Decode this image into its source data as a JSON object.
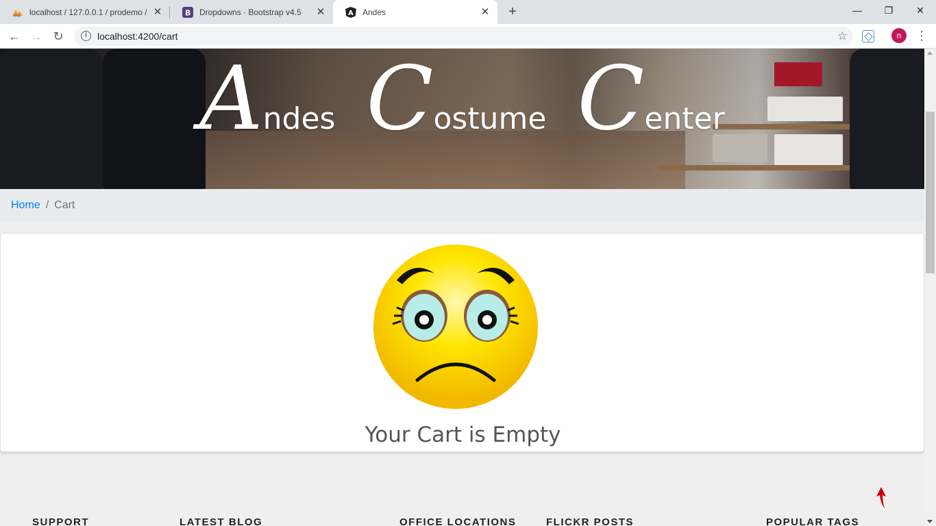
{
  "browser": {
    "tabs": [
      {
        "title": "localhost / 127.0.0.1 / prodemo /",
        "icon": "phpmyadmin-icon",
        "active": false
      },
      {
        "title": "Dropdowns · Bootstrap v4.5",
        "icon": "bootstrap-icon",
        "active": false
      },
      {
        "title": "Andes",
        "icon": "angular-icon",
        "active": true
      }
    ],
    "url": "localhost:4200/cart",
    "avatar_letter": "n"
  },
  "hero": {
    "title_words": [
      {
        "initial": "A",
        "rest": "ndes"
      },
      {
        "initial": "C",
        "rest": "ostume"
      },
      {
        "initial": "C",
        "rest": "enter"
      }
    ]
  },
  "breadcrumb": {
    "home": "Home",
    "separator": "/",
    "current": "Cart"
  },
  "cart": {
    "empty_message": "Your Cart is Empty"
  },
  "footer": {
    "headings": [
      "SUPPORT",
      "LATEST BLOG",
      "OFFICE LOCATIONS",
      "FLICKR POSTS",
      "POPULAR TAGS"
    ]
  },
  "colors": {
    "link": "#007bff",
    "breadcrumb_bg": "#e9ecef",
    "avatar": "#c2185b",
    "back_to_top": "#cc0000"
  }
}
